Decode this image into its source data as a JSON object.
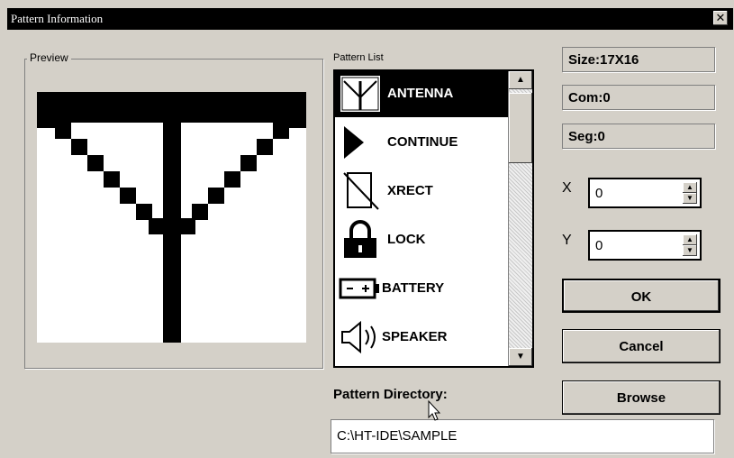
{
  "window": {
    "title": "Pattern Information",
    "close_glyph": "✕"
  },
  "preview": {
    "label": "Preview"
  },
  "pattern_list": {
    "label": "Pattern List",
    "items": [
      {
        "label": "ANTENNA",
        "icon": "antenna-icon",
        "selected": true
      },
      {
        "label": "CONTINUE",
        "icon": "play-arrow-icon",
        "selected": false
      },
      {
        "label": "XRECT",
        "icon": "xrect-icon",
        "selected": false
      },
      {
        "label": "LOCK",
        "icon": "lock-icon",
        "selected": false
      },
      {
        "label": "BATTERY",
        "icon": "battery-icon",
        "selected": false
      },
      {
        "label": "SPEAKER",
        "icon": "speaker-icon",
        "selected": false
      }
    ],
    "scroll_up_glyph": "▲",
    "scroll_down_glyph": "▼"
  },
  "info": {
    "size": "Size:17X16",
    "com": "Com:0",
    "seg": "Seg:0"
  },
  "coords": {
    "x_label": "X",
    "x_value": "0",
    "y_label": "Y",
    "y_value": "0",
    "up_glyph": "▲",
    "down_glyph": "▼"
  },
  "buttons": {
    "ok": "OK",
    "cancel": "Cancel",
    "browse": "Browse"
  },
  "directory": {
    "label": "Pattern Directory:",
    "value": "C:\\HT-IDE\\SAMPLE"
  }
}
